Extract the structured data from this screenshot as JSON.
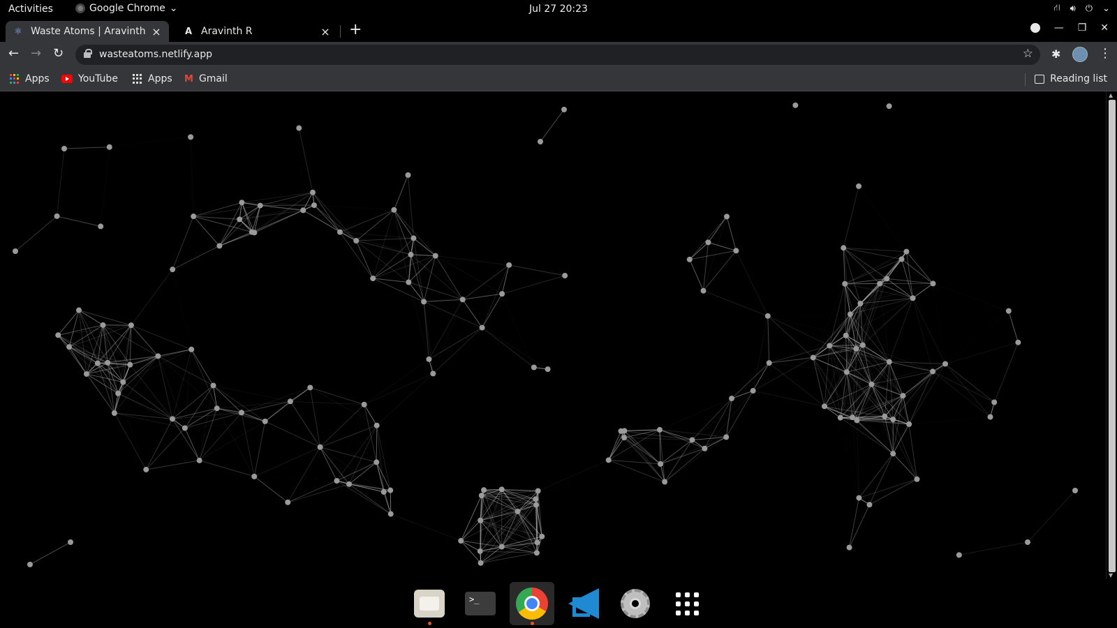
{
  "top_bar": {
    "activities": "Activities",
    "app_name": "Google Chrome",
    "clock": "Jul 27  20:23"
  },
  "tabs": [
    {
      "title": "Waste Atoms | Aravinth",
      "active": true
    },
    {
      "title": "Aravinth R",
      "active": false
    }
  ],
  "omnibox": {
    "url": "wasteatoms.netlify.app"
  },
  "bookmarks": {
    "items": [
      {
        "label": "Apps",
        "icon": "apps-grid-icon"
      },
      {
        "label": "YouTube",
        "icon": "youtube-icon"
      },
      {
        "label": "Apps",
        "icon": "apps-grid-icon"
      },
      {
        "label": "Gmail",
        "icon": "gmail-icon"
      }
    ],
    "reading_list": "Reading list"
  },
  "page": {
    "background": "#000000",
    "particle_color": "#cfcfcf"
  },
  "dock": {
    "items": [
      {
        "name": "files",
        "icon": "files-icon",
        "running": true
      },
      {
        "name": "terminal",
        "icon": "terminal-icon",
        "running": false
      },
      {
        "name": "chrome",
        "icon": "chrome-icon",
        "running": true
      },
      {
        "name": "vscode",
        "icon": "vscode-icon",
        "running": false
      },
      {
        "name": "settings",
        "icon": "settings-icon",
        "running": false
      },
      {
        "name": "show-apps",
        "icon": "apps-grid-icon",
        "running": false
      }
    ]
  },
  "colors": {
    "accent_running_dot": "#e95420",
    "chrome_toolbar": "#35363a",
    "omnibox_bg": "#202124"
  }
}
